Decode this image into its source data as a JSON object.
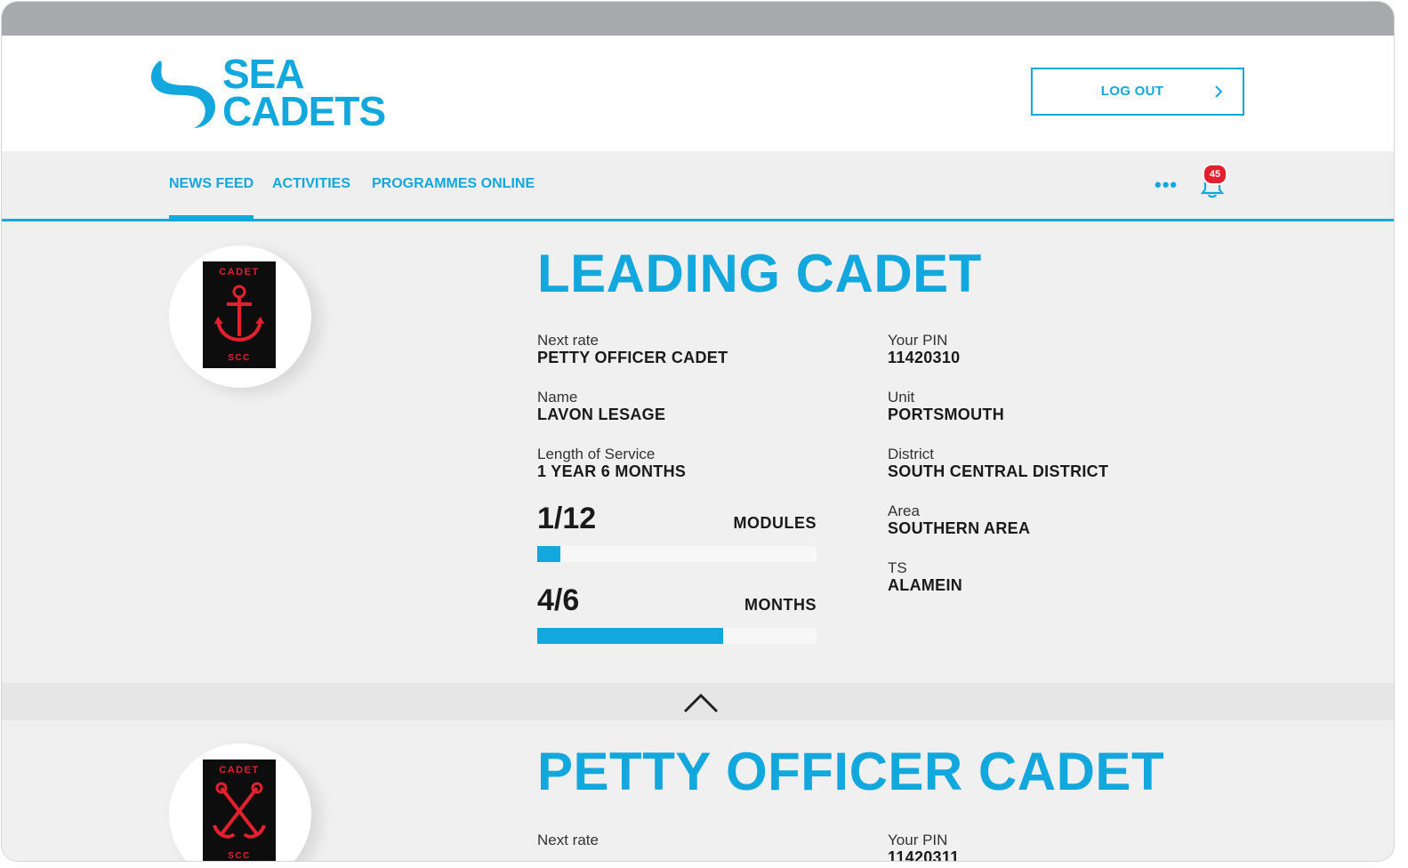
{
  "brand": {
    "line1": "SEA",
    "line2": "CADETS",
    "color": "#13a8dd"
  },
  "header": {
    "logout_label": "LOG OUT"
  },
  "nav": {
    "items": [
      {
        "label": "NEWS FEED",
        "active": true
      },
      {
        "label": "ACTIVITIES",
        "active": false
      },
      {
        "label": "PROGRAMMES ONLINE",
        "active": false
      }
    ],
    "more_label": "•••",
    "notification_count": "45"
  },
  "ranks": [
    {
      "title": "LEADING CADET",
      "patch": {
        "top": "CADET",
        "bottom": "SCC",
        "icon": "anchor-icon"
      },
      "fields": {
        "next_rate": {
          "label": "Next rate",
          "value": "PETTY OFFICER CADET"
        },
        "name": {
          "label": "Name",
          "value": "LAVON LESAGE"
        },
        "service": {
          "label": "Length of Service",
          "value": "1 YEAR 6 MONTHS"
        },
        "pin": {
          "label": "Your PIN",
          "value": "11420310"
        },
        "unit": {
          "label": "Unit",
          "value": "PORTSMOUTH"
        },
        "district": {
          "label": "District",
          "value": "SOUTH CENTRAL DISTRICT"
        },
        "area": {
          "label": "Area",
          "value": "SOUTHERN AREA"
        },
        "ts": {
          "label": "TS",
          "value": "ALAMEIN"
        }
      },
      "modules": {
        "count": "1/12",
        "unit": "MODULES",
        "fraction": 0.083
      },
      "months": {
        "count": "4/6",
        "unit": "MONTHS",
        "fraction": 0.667
      }
    },
    {
      "title": "PETTY OFFICER CADET",
      "patch": {
        "top": "CADET",
        "bottom": "SCC",
        "icon": "crossed-anchors-icon"
      },
      "fields": {
        "next_rate": {
          "label": "Next rate",
          "value": ""
        },
        "pin": {
          "label": "Your PIN",
          "value": "11420311"
        }
      }
    }
  ],
  "colors": {
    "accent": "#13a8dd",
    "badge": "#e3202d",
    "patch_red": "#e3202d"
  }
}
